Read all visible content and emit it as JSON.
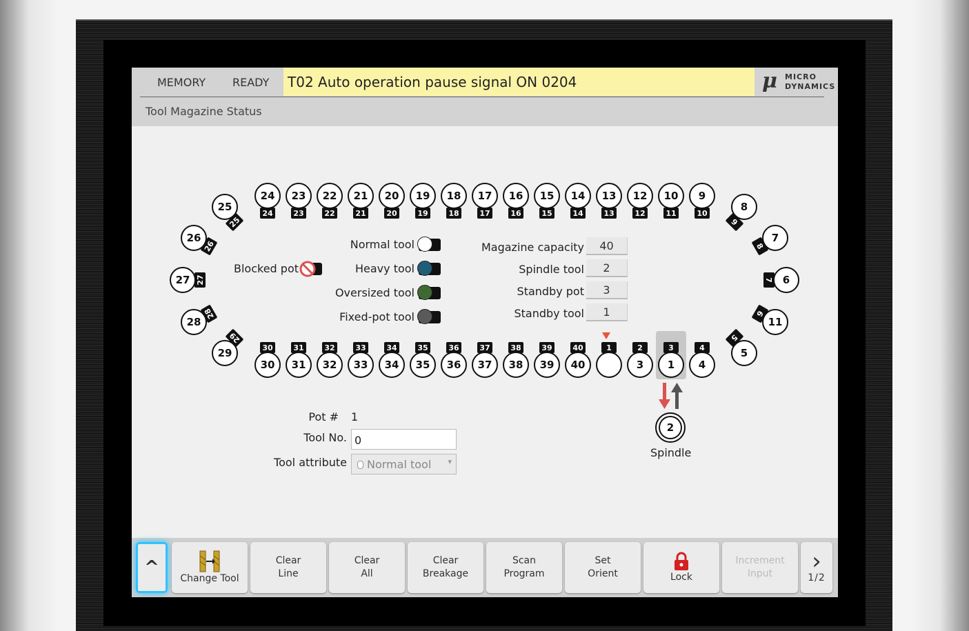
{
  "header": {
    "mode": "MEMORY",
    "state": "READY",
    "message": "T02  Auto operation pause signal ON 0204",
    "logo": {
      "mark": "μ",
      "line1": "MICRO",
      "line2": "DYNAMICS"
    },
    "title": "Tool Magazine Status"
  },
  "magazine": {
    "top_row": [
      {
        "pot": "24",
        "tool": "24"
      },
      {
        "pot": "23",
        "tool": "23"
      },
      {
        "pot": "22",
        "tool": "22"
      },
      {
        "pot": "21",
        "tool": "21"
      },
      {
        "pot": "20",
        "tool": "20"
      },
      {
        "pot": "19",
        "tool": "19"
      },
      {
        "pot": "18",
        "tool": "18"
      },
      {
        "pot": "17",
        "tool": "17"
      },
      {
        "pot": "16",
        "tool": "16"
      },
      {
        "pot": "15",
        "tool": "15"
      },
      {
        "pot": "14",
        "tool": "14"
      },
      {
        "pot": "13",
        "tool": "13"
      },
      {
        "pot": "12",
        "tool": "12"
      },
      {
        "pot": "11",
        "tool": "10"
      },
      {
        "pot": "10",
        "tool": "9"
      }
    ],
    "bottom_row": [
      {
        "pot": "30",
        "tool": "30"
      },
      {
        "pot": "31",
        "tool": "31"
      },
      {
        "pot": "32",
        "tool": "32"
      },
      {
        "pot": "33",
        "tool": "33"
      },
      {
        "pot": "34",
        "tool": "34"
      },
      {
        "pot": "35",
        "tool": "35"
      },
      {
        "pot": "36",
        "tool": "36"
      },
      {
        "pot": "37",
        "tool": "37"
      },
      {
        "pot": "38",
        "tool": "38"
      },
      {
        "pot": "39",
        "tool": "39"
      },
      {
        "pot": "40",
        "tool": "40"
      },
      {
        "pot": "1",
        "tool": ""
      },
      {
        "pot": "2",
        "tool": "3"
      },
      {
        "pot": "3",
        "tool": "1"
      },
      {
        "pot": "4",
        "tool": "4"
      }
    ],
    "left_curve": [
      {
        "pot": "25",
        "tool": "25"
      },
      {
        "pot": "26",
        "tool": "26"
      },
      {
        "pot": "27",
        "tool": "27"
      },
      {
        "pot": "28",
        "tool": "28"
      },
      {
        "pot": "29",
        "tool": "29"
      }
    ],
    "right_curve": [
      {
        "pot": "9",
        "tool": "8"
      },
      {
        "pot": "8",
        "tool": "7"
      },
      {
        "pot": "7",
        "tool": "6"
      },
      {
        "pot": "6",
        "tool": "11"
      },
      {
        "pot": "5",
        "tool": "5"
      }
    ],
    "current_pot_marker": "1",
    "colors": {
      "marker": "#e8543a",
      "arrow_down": "#d9534f",
      "arrow_up": "#555555"
    }
  },
  "legend": {
    "blocked_pot": "Blocked pot",
    "normal_tool": "Normal tool",
    "heavy_tool": "Heavy tool",
    "oversized_tool": "Oversized tool",
    "fixed_pot_tool": "Fixed-pot tool",
    "colors": {
      "normal": "#ffffff",
      "heavy": "#1f5d78",
      "oversized": "#3e6a32",
      "fixed": "#5a5a5a",
      "blocked": "#d9534f"
    }
  },
  "info": {
    "magazine_capacity_label": "Magazine capacity",
    "magazine_capacity": "40",
    "spindle_tool_label": "Spindle tool",
    "spindle_tool": "2",
    "standby_pot_label": "Standby pot",
    "standby_pot": "3",
    "standby_tool_label": "Standby tool",
    "standby_tool": "1"
  },
  "spindle": {
    "tool": "2",
    "label": "Spindle"
  },
  "detail": {
    "pot_label": "Pot #",
    "pot_value": "1",
    "tool_no_label": "Tool No.",
    "tool_no_value": "0",
    "attr_label": "Tool attribute",
    "attr_value": "Normal tool"
  },
  "toolbar": {
    "up_label": "^",
    "change_tool": "Change Tool",
    "clear_line": [
      "Clear",
      "Line"
    ],
    "clear_all": [
      "Clear",
      "All"
    ],
    "clear_breakage": [
      "Clear",
      "Breakage"
    ],
    "scan_program": [
      "Scan",
      "Program"
    ],
    "set_orient": [
      "Set",
      "Orient"
    ],
    "lock": "Lock",
    "increment_input": [
      "Increment",
      "Input"
    ],
    "page": "1/2"
  }
}
